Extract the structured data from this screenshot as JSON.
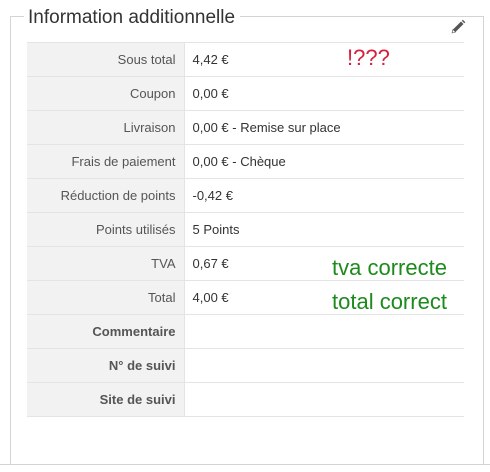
{
  "panel": {
    "title": "Information additionnelle",
    "edit_icon": "pencil-icon"
  },
  "rows": [
    {
      "label": "Sous total",
      "value": "4,42 €",
      "bold": false
    },
    {
      "label": "Coupon",
      "value": "0,00 €",
      "bold": false
    },
    {
      "label": "Livraison",
      "value": "0,00 € - Remise sur place",
      "bold": false
    },
    {
      "label": "Frais de paiement",
      "value": "0,00 € - Chèque",
      "bold": false
    },
    {
      "label": "Réduction de points",
      "value": "-0,42 €",
      "bold": false
    },
    {
      "label": "Points utilisés",
      "value": "5 Points",
      "bold": false
    },
    {
      "label": "TVA",
      "value": "0,67 €",
      "bold": false
    },
    {
      "label": "Total",
      "value": "4,00 €",
      "bold": false
    },
    {
      "label": "Commentaire",
      "value": "",
      "bold": true
    },
    {
      "label": "N° de suivi",
      "value": "",
      "bold": true
    },
    {
      "label": "Site de suivi",
      "value": "",
      "bold": true
    }
  ],
  "annotations": {
    "subtotal_note": "!???",
    "tva_note": "tva correcte",
    "total_note": "total correct"
  },
  "colors": {
    "annotation_red": "#d81e3a",
    "annotation_green": "#1c8a1c",
    "label_bg": "#f2f2f2",
    "border": "#d4d4d4"
  }
}
